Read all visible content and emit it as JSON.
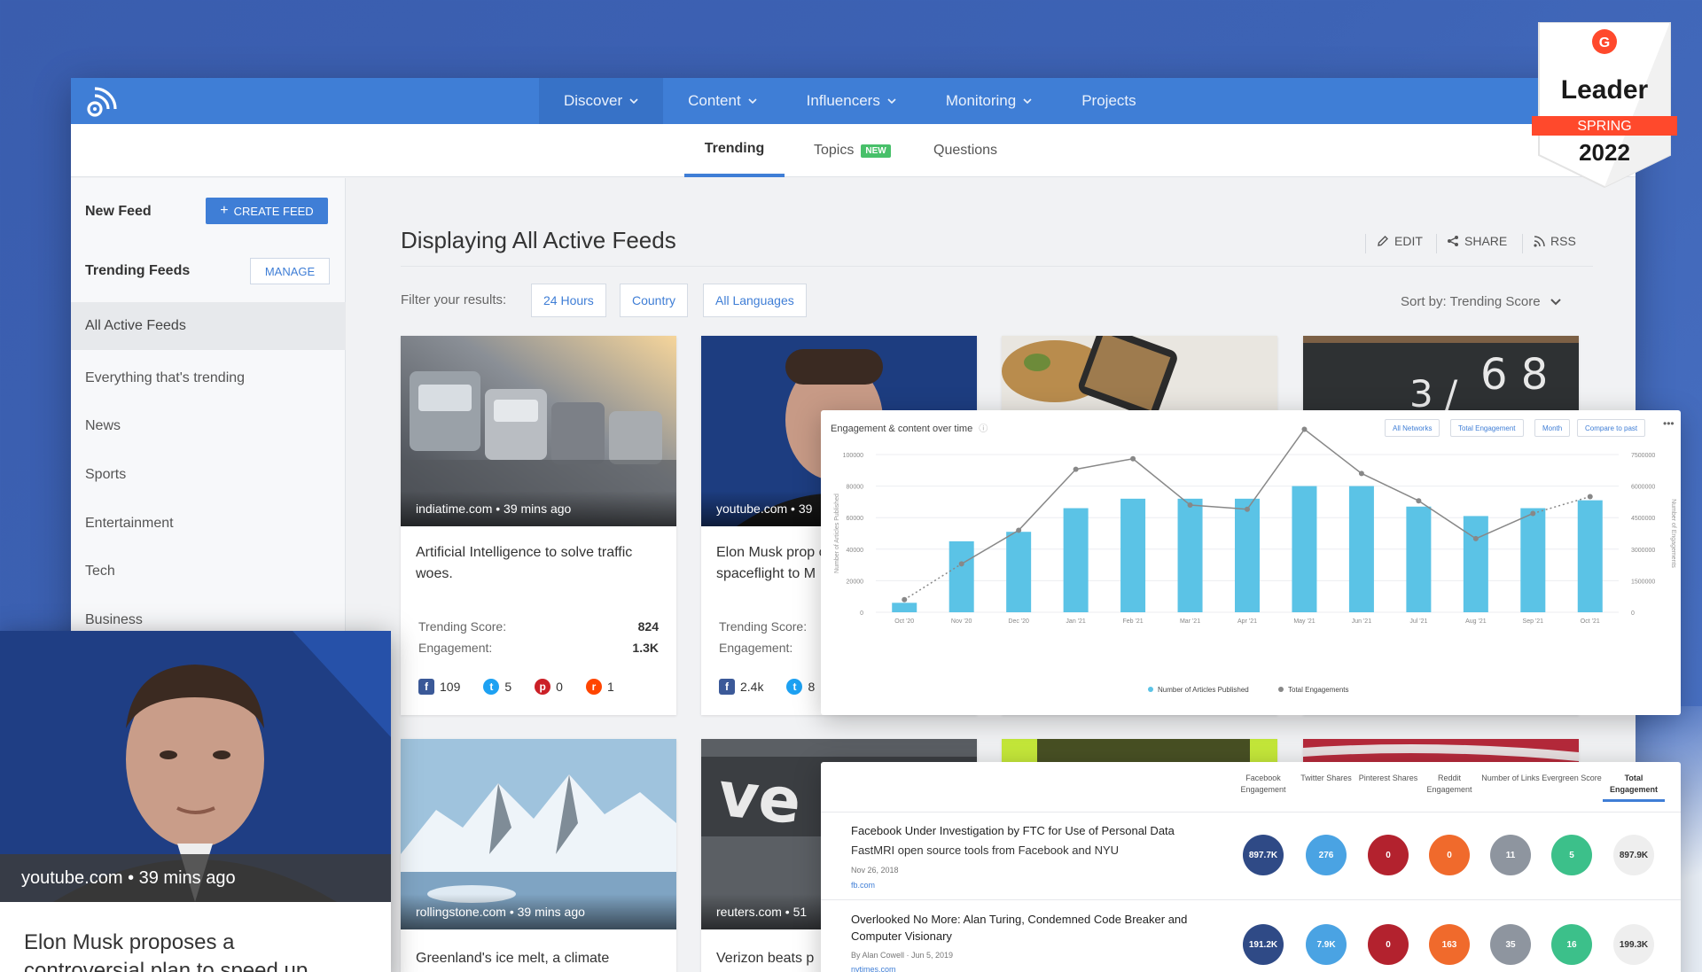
{
  "nav": {
    "items": [
      {
        "label": "Discover",
        "chevron": true
      },
      {
        "label": "Content",
        "chevron": true
      },
      {
        "label": "Influencers",
        "chevron": true
      },
      {
        "label": "Monitoring",
        "chevron": true
      },
      {
        "label": "Projects",
        "chevron": false
      }
    ],
    "active": "Discover"
  },
  "subnav": {
    "tabs": [
      {
        "label": "Trending",
        "active": true
      },
      {
        "label": "Topics",
        "badge": "NEW"
      },
      {
        "label": "Questions"
      }
    ]
  },
  "sidebar": {
    "new_feed": "New Feed",
    "create_feed": "CREATE FEED",
    "trending_feeds": "Trending Feeds",
    "manage": "MANAGE",
    "items": [
      "All Active Feeds",
      "Everything that's trending",
      "News",
      "Sports",
      "Entertainment",
      "Tech",
      "Business"
    ]
  },
  "main": {
    "title": "Displaying All Active Feeds",
    "actions": {
      "edit": "EDIT",
      "share": "SHARE",
      "rss": "RSS"
    },
    "filter_label": "Filter your results:",
    "filters": [
      "24 Hours",
      "Country",
      "All Languages"
    ],
    "sort": "Sort by: Trending Score"
  },
  "cards": [
    {
      "source": "indiatime.com • 39 mins ago",
      "title": "Artificial Intelligence to solve traffic woes.",
      "trending_label": "Trending Score:",
      "trending": "824",
      "engagement_label": "Engagement:",
      "engagement": "1.3K",
      "social": {
        "facebook": "109",
        "twitter": "5",
        "pinterest": "0",
        "reddit": "1"
      }
    },
    {
      "source": "youtube.com • 39",
      "title": "Elon Musk prop controversial pl spaceflight to M",
      "trending_label": "Trending Score:",
      "engagement_label": "Engagement:",
      "social": {
        "facebook": "2.4k",
        "twitter": "8"
      }
    },
    {
      "source": "rollingstone.com • 39 mins ago",
      "title": "Greenland's ice melt, a climate"
    },
    {
      "source": "reuters.com • 51",
      "title": "Verizon beats p"
    }
  ],
  "overlay_card": {
    "source": "youtube.com • 39 mins ago",
    "title": "Elon Musk proposes a controversial plan to speed up"
  },
  "chart_panel": {
    "title": "Engagement & content over time",
    "pills": [
      "All Networks",
      "Total Engagement",
      "Month",
      "Compare to past"
    ],
    "more": "•••"
  },
  "chart_data": {
    "type": "bar",
    "categories": [
      "Oct '20",
      "Nov '20",
      "Dec '20",
      "Jan '21",
      "Feb '21",
      "Mar '21",
      "Apr '21",
      "May '21",
      "Jun '21",
      "Jul '21",
      "Aug '21",
      "Sep '21",
      "Oct '21"
    ],
    "series": [
      {
        "name": "Number of Articles Published",
        "type": "bar",
        "axis": "left",
        "color": "#5bc3e6",
        "values": [
          6000,
          45000,
          51000,
          66000,
          72000,
          72000,
          72000,
          80000,
          80000,
          67000,
          61000,
          66000,
          71000
        ]
      },
      {
        "name": "Total Engagements",
        "type": "line",
        "axis": "right",
        "color": "#888888",
        "values": [
          600000,
          2300000,
          3900000,
          6800000,
          7300000,
          5100000,
          4900000,
          8700000,
          6600000,
          5300000,
          3500000,
          4700000,
          5500000
        ]
      }
    ],
    "ylabel": "Number of Articles Published",
    "y2label": "Number of Engagements",
    "ylim": [
      0,
      100000
    ],
    "y2lim": [
      0,
      7500000
    ],
    "yticks": [
      "0",
      "20000",
      "40000",
      "60000",
      "80000",
      "100000"
    ],
    "y2ticks": [
      "0",
      "1500000",
      "3000000",
      "4500000",
      "6000000",
      "7500000"
    ],
    "legend": "bottom"
  },
  "table_panel": {
    "headers": [
      "Facebook Engagement",
      "Twitter Shares",
      "Pinterest Shares",
      "Reddit Engagement",
      "Number of Links",
      "Evergreen Score",
      "Total Engagement"
    ],
    "rows": [
      {
        "title": "Facebook Under Investigation by FTC for Use of Personal Data",
        "subtitle": "FastMRI open source tools from Facebook and NYU",
        "date": "Nov 26, 2018",
        "link": "fb.com",
        "values": [
          "897.7K",
          "276",
          "0",
          "0",
          "11",
          "5",
          "897.9K"
        ]
      },
      {
        "title": "Overlooked No More: Alan Turing, Condemned Code Breaker and Computer Visionary",
        "date": "By Alan Cowell · Jun 5, 2019",
        "link": "nytimes.com",
        "values": [
          "191.2K",
          "7.9K",
          "0",
          "163",
          "35",
          "16",
          "199.3K"
        ]
      }
    ],
    "colors": [
      "#2f4a86",
      "#4aa3e3",
      "#b3222e",
      "#f06a2c",
      "#8e959f",
      "#3cc08a",
      "#eeeeee"
    ]
  },
  "g2_badge": {
    "top": "Leader",
    "ribbon": "SPRING",
    "year": "2022",
    "brand_color": "#ff492c"
  }
}
